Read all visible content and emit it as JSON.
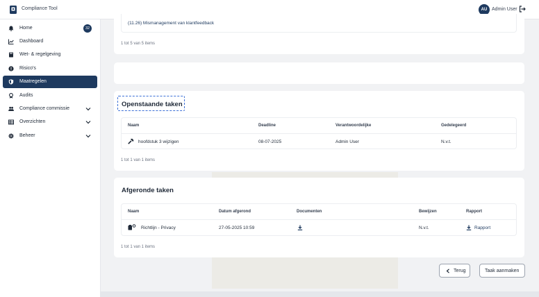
{
  "app": {
    "title": "Compliance Tool"
  },
  "user": {
    "initials": "AU",
    "name": "Admin User"
  },
  "sidebar": {
    "items": [
      {
        "label": "Home",
        "badge": "32"
      },
      {
        "label": "Dashboard"
      },
      {
        "label": "Wet- & regelgeving"
      },
      {
        "label": "Risico's"
      },
      {
        "label": "Maatregelen",
        "active": true
      },
      {
        "label": "Audits"
      },
      {
        "label": "Compliance commissie"
      },
      {
        "label": "Overzichten"
      },
      {
        "label": "Beheer"
      }
    ]
  },
  "previous_card": {
    "item": "(11.26) Mismanagement van klantfeedback",
    "pager": "1 tot 5 van 5 items"
  },
  "open_tasks": {
    "title": "Openstaande taken",
    "columns": [
      "Naam",
      "Deadline",
      "Verantwoordelijke",
      "Gedelegeerd"
    ],
    "rows": [
      {
        "name": "hoofdstuk 3 wijzigen",
        "deadline": "08-07-2025",
        "responsible": "Admin User",
        "delegated": "N.v.t."
      }
    ],
    "pager": "1 tot 1 van 1 items"
  },
  "done_tasks": {
    "title": "Afgeronde taken",
    "columns": [
      "Naam",
      "Datum afgerond",
      "Documenten",
      "Bewijzen",
      "Rapport"
    ],
    "rows": [
      {
        "name": "Richtlijn - Privacy",
        "date": "27-05-2025 10:59",
        "evidence": "N.v.t.",
        "report": "Rapport"
      }
    ],
    "pager": "1 tot 1 van 1 items"
  },
  "actions": {
    "back": "Terug",
    "create": "Taak aanmaken"
  },
  "colors": {
    "primary": "#1e3a5f",
    "focus": "#3b6fd6"
  }
}
